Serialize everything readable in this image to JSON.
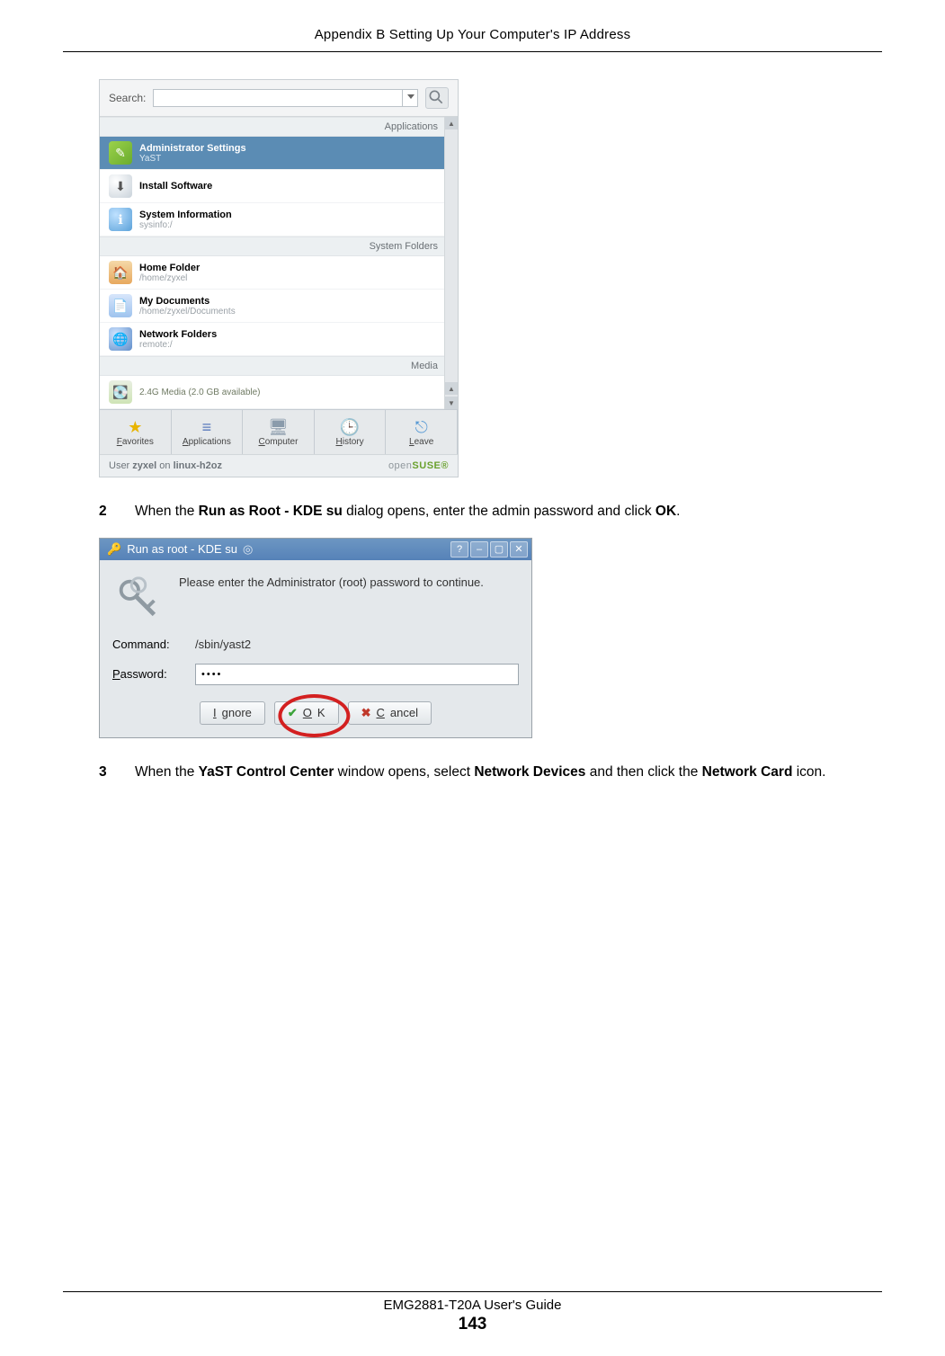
{
  "header": "Appendix B Setting Up Your Computer's IP Address",
  "kickoff": {
    "search_label": "Search:",
    "search_value": "",
    "categories": {
      "apps": "Applications",
      "sysfold": "System Folders",
      "media": "Media"
    },
    "items": {
      "admin": {
        "title": "Administrator Settings",
        "sub": "YaST"
      },
      "install": {
        "title": "Install Software",
        "sub": ""
      },
      "sysinfo": {
        "title": "System Information",
        "sub": "sysinfo:/"
      },
      "home": {
        "title": "Home Folder",
        "sub": "/home/zyxel"
      },
      "docs": {
        "title": "My Documents",
        "sub": "/home/zyxel/Documents"
      },
      "net": {
        "title": "Network Folders",
        "sub": "remote:/"
      },
      "drive": {
        "title": "2.4G Media (2.0 GB available)",
        "sub": ""
      }
    },
    "tabs": {
      "fav": "Favorites",
      "apps": "Applications",
      "comp": "Computer",
      "hist": "History",
      "leave": "Leave"
    },
    "footer_user_prefix": "User ",
    "footer_user": "zyxel",
    "footer_on": " on ",
    "footer_host": "linux-h2oz",
    "footer_brand_pre": "open",
    "footer_brand": "SUSE"
  },
  "step2": {
    "num": "2",
    "text_a": "When the ",
    "bold_a": "Run as Root - KDE su",
    "text_b": " dialog opens, enter the admin password and click ",
    "bold_b": "OK",
    "text_c": "."
  },
  "kdesu": {
    "title": "Run as root - KDE su",
    "msg": "Please enter the Administrator (root) password to continue.",
    "command_label": "Command:",
    "command_value": "/sbin/yast2",
    "password_label": "Password:",
    "password_value": "••••",
    "btn_ignore": "Ignore",
    "btn_ok": "OK",
    "btn_cancel": "Cancel"
  },
  "step3": {
    "num": "3",
    "text_a": "When the ",
    "bold_a": "YaST Control Center",
    "text_b": " window opens, select ",
    "bold_b": "Network Devices",
    "text_c": " and then click the ",
    "bold_c": "Network Card",
    "text_d": " icon."
  },
  "footer": {
    "guide": "EMG2881-T20A User's Guide",
    "page": "143"
  }
}
